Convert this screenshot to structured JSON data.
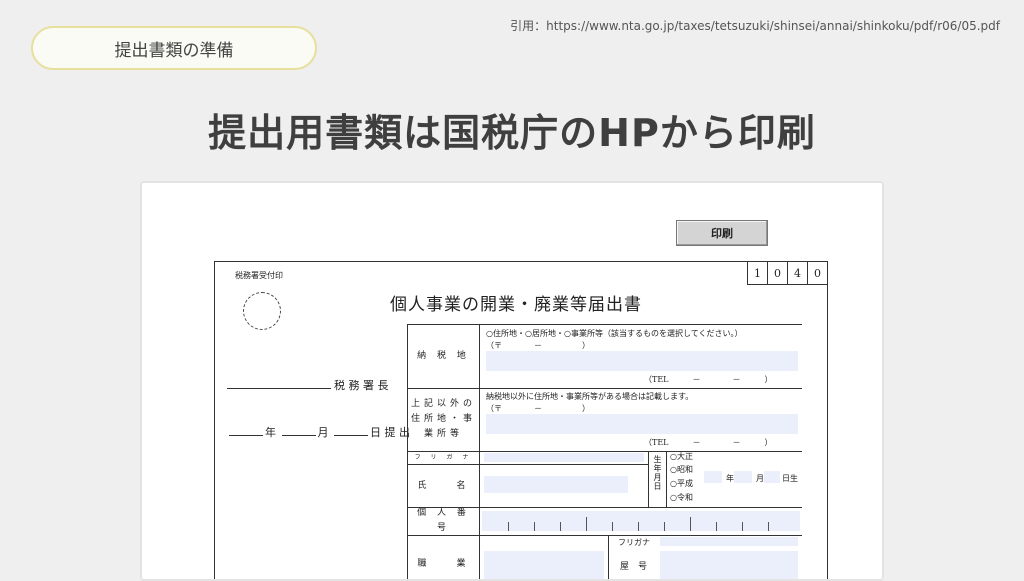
{
  "header": {
    "pill_label": "提出書類の準備",
    "citation": "引用：https://www.nta.go.jp/taxes/tetsuzuki/shinsei/annai/shinkoku/pdf/r06/05.pdf",
    "headline": "提出用書類は国税庁のHPから印刷"
  },
  "form": {
    "print_button": "印刷",
    "stamp_label": "税務署受付印",
    "code": [
      "1",
      "0",
      "4",
      "0"
    ],
    "title": "個人事業の開業・廃業等届出書",
    "tax_office_suffix": "税 務 署 長",
    "date_year": "年",
    "date_month": "月",
    "date_day_submit": "日 提 出",
    "rows": {
      "nozeichi": "納 税 地",
      "address_choice": "○住所地・○居所地・○事業所等（該当するものを選択してください。）",
      "postal": "（〒　　　　－　　　　　）",
      "tel": "（TEL　　　－　　　　－　　　）",
      "other_address_label": "上記以外の住所地・事業所等",
      "other_address_note": "納税地以外に住所地・事業所等がある場合は記載します。",
      "furigana": "フ リ ガ ナ",
      "name": "氏　　名",
      "birth_label": "生年月日",
      "eras": [
        "○大正",
        "○昭和",
        "○平成",
        "○令和"
      ],
      "birth_y": "年",
      "birth_m": "月",
      "birth_d": "日生",
      "my_number": "個 人 番 号",
      "occupation": "職　　業",
      "furigana2": "フリガナ",
      "trade_name": "屋　号"
    }
  }
}
